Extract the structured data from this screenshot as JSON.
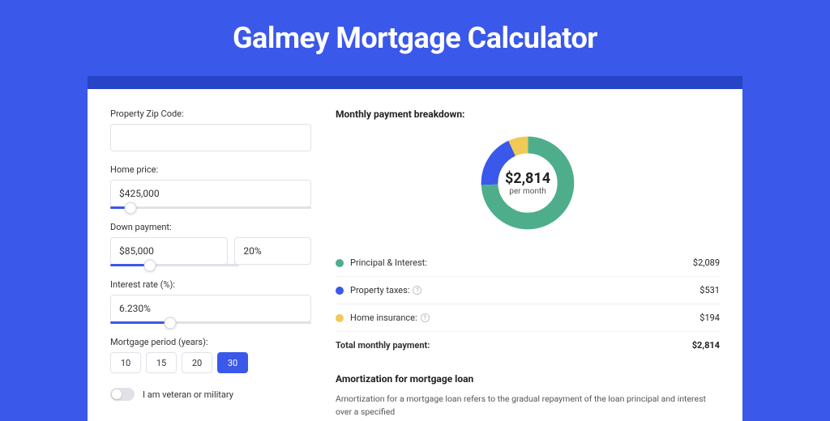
{
  "title": "Galmey Mortgage Calculator",
  "form": {
    "zip_label": "Property Zip Code:",
    "zip_value": "",
    "home_price_label": "Home price:",
    "home_price_value": "$425,000",
    "home_price_slider_pct": 10,
    "down_payment_label": "Down payment:",
    "down_payment_amount": "$85,000",
    "down_payment_pct": "20%",
    "down_payment_slider_pct": 20,
    "interest_label": "Interest rate (%):",
    "interest_value": "6.230%",
    "interest_slider_pct": 30,
    "period_label": "Mortgage period (years):",
    "periods": [
      "10",
      "15",
      "20",
      "30"
    ],
    "period_active": "30",
    "veteran_label": "I am veteran or military",
    "veteran_on": false
  },
  "breakdown": {
    "title": "Monthly payment breakdown:",
    "center_amount": "$2,814",
    "center_sub": "per month",
    "items": [
      {
        "label": "Principal & Interest:",
        "value": "$2,089",
        "color": "#4eae8c",
        "info": false
      },
      {
        "label": "Property taxes:",
        "value": "$531",
        "color": "#3a58e9",
        "info": true
      },
      {
        "label": "Home insurance:",
        "value": "$194",
        "color": "#f0c957",
        "info": true
      }
    ],
    "total_label": "Total monthly payment:",
    "total_value": "$2,814"
  },
  "amortization": {
    "title": "Amortization for mortgage loan",
    "text": "Amortization for a mortgage loan refers to the gradual repayment of the loan principal and interest over a specified"
  },
  "chart_data": {
    "type": "pie",
    "title": "Monthly payment breakdown",
    "series": [
      {
        "name": "Principal & Interest",
        "value": 2089,
        "color": "#4eae8c"
      },
      {
        "name": "Property taxes",
        "value": 531,
        "color": "#3a58e9"
      },
      {
        "name": "Home insurance",
        "value": 194,
        "color": "#f0c957"
      }
    ],
    "total": 2814
  }
}
